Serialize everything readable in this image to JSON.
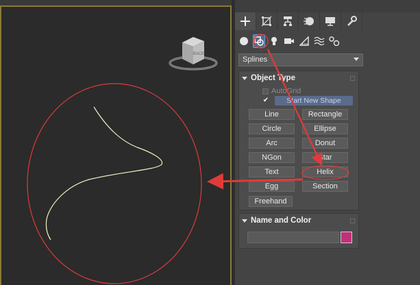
{
  "command_panel": {
    "tabs": [
      {
        "id": "create",
        "icon": "plus-icon"
      },
      {
        "id": "modify",
        "icon": "modify-icon"
      },
      {
        "id": "hierarchy",
        "icon": "hierarchy-icon"
      },
      {
        "id": "motion",
        "icon": "motion-icon"
      },
      {
        "id": "display",
        "icon": "display-monitor-icon"
      },
      {
        "id": "utilities",
        "icon": "wrench-icon"
      }
    ],
    "categories": [
      {
        "id": "geometry",
        "icon": "sphere-icon"
      },
      {
        "id": "shapes",
        "icon": "shapes-icon"
      },
      {
        "id": "lights",
        "icon": "light-bulb-icon"
      },
      {
        "id": "cameras",
        "icon": "camera-icon"
      },
      {
        "id": "helpers",
        "icon": "helper-icon"
      },
      {
        "id": "space_warps",
        "icon": "space-warp-icon"
      },
      {
        "id": "systems",
        "icon": "systems-icon"
      }
    ],
    "dropdown_value": "Splines",
    "object_type": {
      "title": "Object Type",
      "autogrid_label": "AutoGrid",
      "start_new_shape_label": "Start New Shape",
      "buttons": [
        "Line",
        "Rectangle",
        "Circle",
        "Ellipse",
        "Arc",
        "Donut",
        "NGon",
        "Star",
        "Text",
        "Helix",
        "Egg",
        "Section",
        "Freehand"
      ]
    },
    "name_and_color": {
      "title": "Name and Color",
      "name_value": "",
      "color": "#c2307a"
    }
  },
  "viewport": {
    "viewcube_label": "BACK"
  },
  "colors": {
    "annotation": "#e23a3a",
    "curve": "#f0f0c0",
    "viewport_border": "#8a7a35"
  }
}
